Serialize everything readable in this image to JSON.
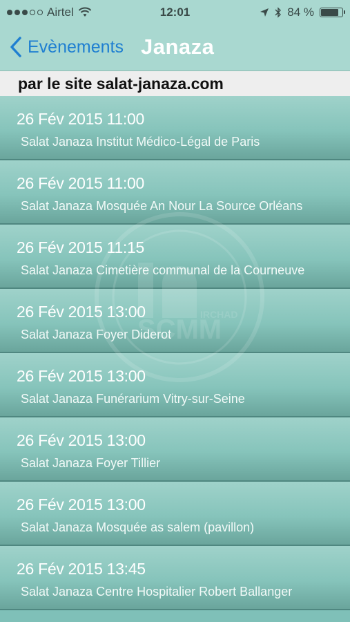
{
  "status_bar": {
    "signal_dots_filled": 3,
    "signal_dots_total": 5,
    "carrier": "Airtel",
    "time": "12:01",
    "battery_text": "84 %",
    "battery_level": 0.84,
    "icons": [
      "wifi-icon",
      "location-arrow-icon",
      "bluetooth-icon",
      "battery-icon"
    ]
  },
  "nav": {
    "back_label": "Evènements",
    "title": "Janaza"
  },
  "source": {
    "text": "par le site salat-janaza.com"
  },
  "watermark": {
    "text": "SCMM",
    "subtext": "IRCHAD"
  },
  "events": [
    {
      "date": "26 Fév 2015 11:00",
      "place": "Salat Janaza Institut Médico-Légal de Paris"
    },
    {
      "date": "26 Fév 2015 11:00",
      "place": "Salat Janaza Mosquée An Nour La Source Orléans"
    },
    {
      "date": "26 Fév 2015 11:15",
      "place": "Salat Janaza Cimetière communal de la Courneuve"
    },
    {
      "date": "26 Fév 2015 13:00",
      "place": "Salat Janaza Foyer Diderot"
    },
    {
      "date": "26 Fév 2015 13:00",
      "place": "Salat Janaza Funérarium Vitry-sur-Seine"
    },
    {
      "date": "26 Fév 2015 13:00",
      "place": "Salat Janaza Foyer Tillier"
    },
    {
      "date": "26 Fév 2015 13:00",
      "place": "Salat Janaza Mosquée as salem (pavillon)"
    },
    {
      "date": "26 Fév 2015 13:45",
      "place": "Salat Janaza Centre Hospitalier Robert Ballanger"
    }
  ],
  "colors": {
    "nav_bg": "#a9d8d0",
    "back_blue": "#1f7fd1",
    "row_top": "#9fd2ca",
    "row_bottom": "#6aa59c"
  }
}
